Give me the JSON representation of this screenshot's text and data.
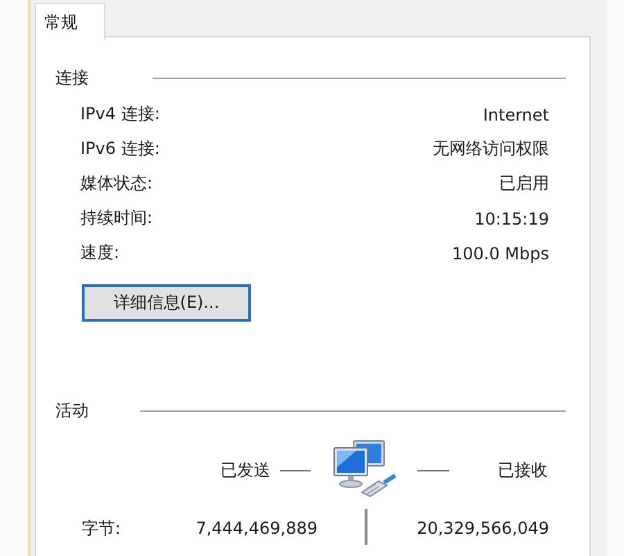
{
  "tabs": [
    {
      "label": "常规",
      "selected": true
    }
  ],
  "connection": {
    "heading": "连接",
    "rows": [
      {
        "label": "IPv4 连接:",
        "value": "Internet"
      },
      {
        "label": "IPv6 连接:",
        "value": "无网络访问权限"
      },
      {
        "label": "媒体状态:",
        "value": "已启用"
      },
      {
        "label": "持续时间:",
        "value": "10:15:19"
      },
      {
        "label": "速度:",
        "value": "100.0 Mbps"
      }
    ],
    "details_button": "详细信息(E)..."
  },
  "activity": {
    "heading": "活动",
    "sent_label": "已发送",
    "received_label": "已接收",
    "rows": [
      {
        "label": "字节:",
        "sent": "7,444,469,889",
        "received": "20,329,566,049"
      }
    ]
  }
}
